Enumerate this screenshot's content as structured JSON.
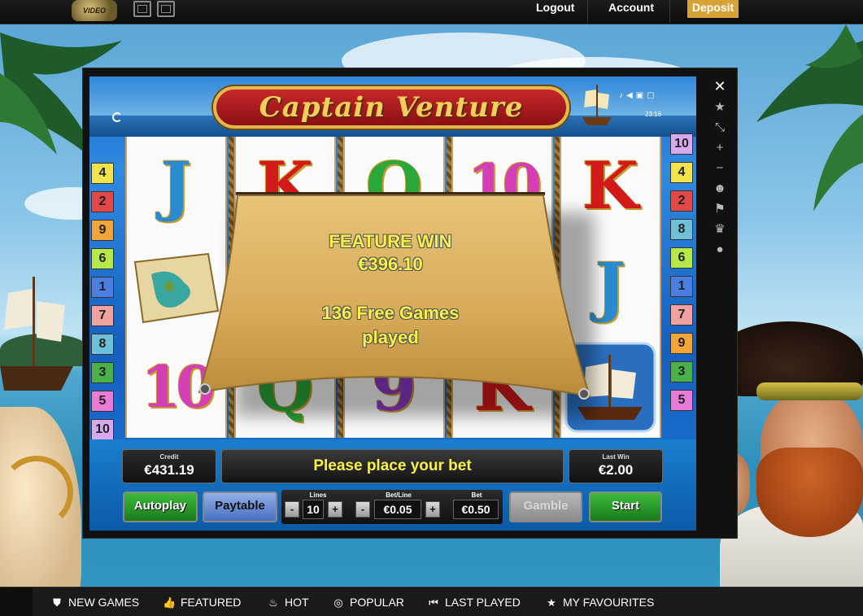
{
  "header": {
    "logo_text": "VIDEO SLOTS",
    "logout": "Logout",
    "account": "Account",
    "deposit": "Deposit"
  },
  "game": {
    "title": "Captain Venture",
    "clock": "23:16",
    "lines_left": [
      "4",
      "2",
      "9",
      "6",
      "1",
      "7",
      "8",
      "3",
      "5",
      "10"
    ],
    "lines_right": [
      "10",
      "4",
      "2",
      "8",
      "6",
      "1",
      "7",
      "9",
      "3",
      "5"
    ],
    "line_colors": [
      "#f3e34a",
      "#e24848",
      "#f2a53a",
      "#b7e84a",
      "#4a7ee0",
      "#f0a2a0",
      "#6ec0d8",
      "#4cb04a",
      "#e87ad8",
      "#d8a8f0"
    ],
    "line_colors_right": [
      "#d8a8f0",
      "#f3e34a",
      "#e24848",
      "#6ec0d8",
      "#b7e84a",
      "#4a7ee0",
      "#f0a2a0",
      "#f2a53a",
      "#4cb04a",
      "#e87ad8"
    ],
    "reels": [
      [
        "J",
        "map",
        "10"
      ],
      [
        "K",
        "",
        "Q"
      ],
      [
        "Q",
        "",
        "9"
      ],
      [
        "10",
        "",
        "K"
      ],
      [
        "K",
        "J",
        "ship"
      ]
    ],
    "feature": {
      "title": "FEATURE WIN",
      "amount": "€396.10",
      "message_line1": "136 Free Games",
      "message_line2": "played"
    },
    "panel": {
      "credit_label": "Credit",
      "credit_value": "€431.19",
      "status": "Please place your bet",
      "last_win_label": "Last Win",
      "last_win_value": "€2.00",
      "autoplay": "Autoplay",
      "paytable": "Paytable",
      "lines_label": "Lines",
      "lines_value": "10",
      "betline_label": "Bet/Line",
      "betline_value": "€0.05",
      "bet_label": "Bet",
      "bet_value": "€0.50",
      "gamble": "Gamble",
      "start": "Start",
      "minus": "-",
      "plus": "+"
    }
  },
  "side_tools": [
    "close-icon",
    "star-icon",
    "shrink-icon",
    "zoom-in-icon",
    "zoom-out-icon",
    "user-icon",
    "flags-icon",
    "trophy-icon",
    "chat-icon"
  ],
  "side_tool_glyphs": [
    "✕",
    "★",
    "⤡",
    "+",
    "−",
    "☻",
    "⚑",
    "♛",
    "●"
  ],
  "bottom_nav": [
    {
      "label": "NEW GAMES",
      "icon": "shield-icon",
      "glyph": "⛊"
    },
    {
      "label": "FEATURED",
      "icon": "thumbs-up-icon",
      "glyph": "👍"
    },
    {
      "label": "HOT",
      "icon": "flame-icon",
      "glyph": "♨"
    },
    {
      "label": "POPULAR",
      "icon": "popular-icon",
      "glyph": "◎"
    },
    {
      "label": "LAST PLAYED",
      "icon": "rewind-icon",
      "glyph": "⏮"
    },
    {
      "label": "MY FAVOURITES",
      "icon": "star-icon",
      "glyph": "★"
    }
  ]
}
